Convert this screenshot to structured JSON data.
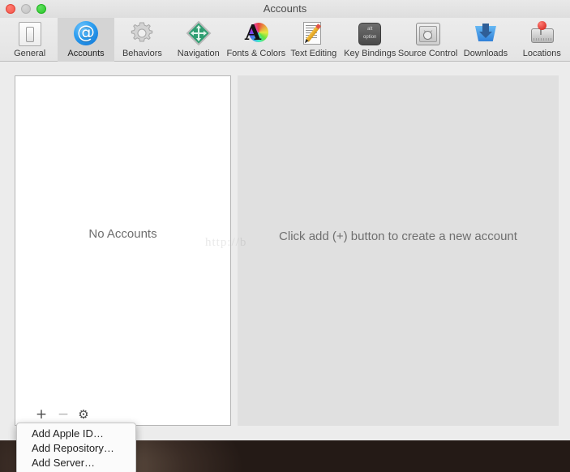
{
  "window": {
    "title": "Accounts",
    "traffic_lights": [
      {
        "name": "close",
        "color": "#f4554a"
      },
      {
        "name": "minimize",
        "color": "#c2c2c2"
      },
      {
        "name": "zoom",
        "color": "#2bc72b"
      }
    ]
  },
  "toolbar": {
    "items": [
      {
        "label": "General",
        "icon": "device-icon",
        "selected": false
      },
      {
        "label": "Accounts",
        "icon": "at-sign-icon",
        "selected": true
      },
      {
        "label": "Behaviors",
        "icon": "gear-icon",
        "selected": false
      },
      {
        "label": "Navigation",
        "icon": "move-diamond-icon",
        "selected": false
      },
      {
        "label": "Fonts & Colors",
        "icon": "font-colorwheel-icon",
        "selected": false
      },
      {
        "label": "Text Editing",
        "icon": "pencil-page-icon",
        "selected": false
      },
      {
        "label": "Key Bindings",
        "icon": "keycap-icon",
        "selected": false
      },
      {
        "label": "Source Control",
        "icon": "safe-icon",
        "selected": false
      },
      {
        "label": "Downloads",
        "icon": "download-tray-icon",
        "selected": false
      },
      {
        "label": "Locations",
        "icon": "disk-pin-icon",
        "selected": false
      }
    ],
    "accounts_glyph": "@"
  },
  "accounts_list": {
    "empty_message": "No Accounts"
  },
  "detail_pane": {
    "hint": "Click add (+) button to create a new account"
  },
  "watermark": {
    "text": "http://b"
  },
  "bottom_bar": {
    "add_label": "+",
    "remove_label": "−",
    "gear_label": "⚙"
  },
  "add_menu": {
    "items": [
      {
        "label": "Add Apple ID…"
      },
      {
        "label": "Add Repository…"
      },
      {
        "label": "Add Server…"
      }
    ]
  },
  "icon_text": {
    "key_top": "alt",
    "key_bottom": "option",
    "font_letter": "A"
  }
}
